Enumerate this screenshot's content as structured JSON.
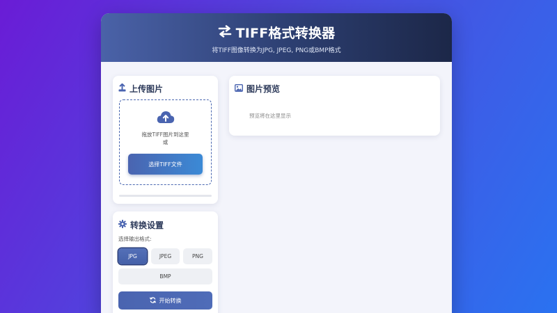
{
  "header": {
    "title": "TIFF格式转换器",
    "subtitle": "将TIFF图像转换为JPG, JPEG, PNG或BMP格式",
    "icon": "swap-arrows-icon"
  },
  "upload": {
    "title": "上传图片",
    "icon": "upload-icon",
    "drop_text": "拖放TIFF图片到这里",
    "or_text": "或",
    "select_button": "选择TIFF文件",
    "cloud_icon": "cloud-upload-icon",
    "progress": 0
  },
  "preview": {
    "title": "图片预览",
    "icon": "image-icon",
    "placeholder": "预览将在这里显示"
  },
  "settings": {
    "title": "转换设置",
    "icon": "gear-icon",
    "format_label": "选择输出格式:",
    "formats": [
      "JPG",
      "JPEG",
      "PNG",
      "BMP"
    ],
    "selected_format": "JPG",
    "convert_button": "开始转换",
    "convert_icon": "refresh-icon"
  },
  "colors": {
    "accent": "#4a64b0",
    "header_dark": "#1c2748"
  }
}
